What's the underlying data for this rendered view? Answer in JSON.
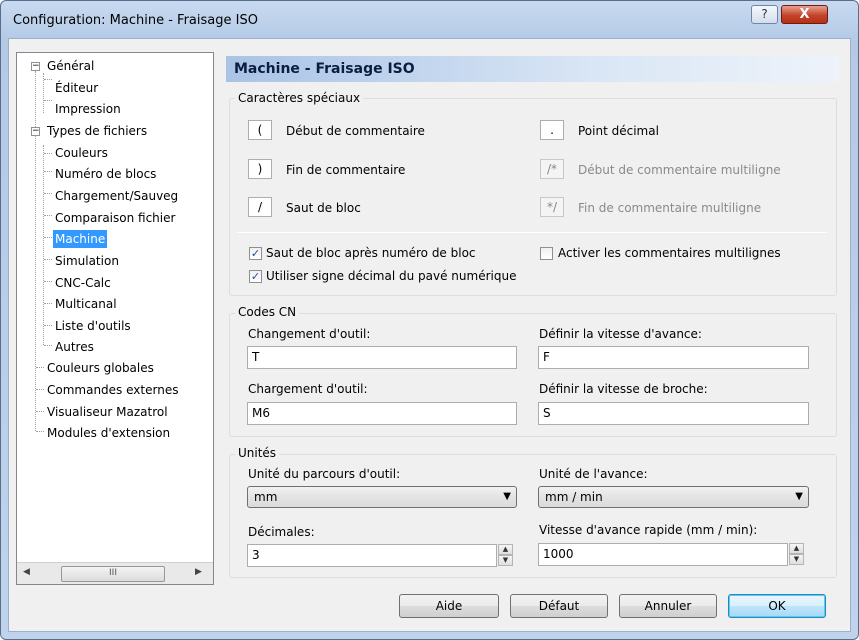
{
  "window": {
    "title": "Configuration: Machine - Fraisage ISO",
    "help_glyph": "?",
    "close_glyph": "X"
  },
  "tree": {
    "items": [
      {
        "label": "Général"
      },
      {
        "label": "Éditeur"
      },
      {
        "label": "Impression"
      },
      {
        "label": "Types de fichiers"
      },
      {
        "label": "Couleurs"
      },
      {
        "label": "Numéro de blocs"
      },
      {
        "label": "Chargement/Sauveg"
      },
      {
        "label": "Comparaison fichier"
      },
      {
        "label": "Machine"
      },
      {
        "label": "Simulation"
      },
      {
        "label": "CNC-Calc"
      },
      {
        "label": "Multicanal"
      },
      {
        "label": "Liste d'outils"
      },
      {
        "label": "Autres"
      },
      {
        "label": "Couleurs globales"
      },
      {
        "label": "Commandes externes"
      },
      {
        "label": "Visualiseur Mazatrol"
      },
      {
        "label": "Modules d'extension"
      }
    ],
    "expander_glyph": "−",
    "scroll_thumb_glyph": "III"
  },
  "panel": {
    "title": "Machine - Fraisage ISO"
  },
  "special_chars": {
    "group_label": "Caractères spéciaux",
    "comment_start": {
      "char": "(",
      "label": "Début de commentaire"
    },
    "comment_end": {
      "char": ")",
      "label": "Fin de commentaire"
    },
    "block_skip": {
      "char": "/",
      "label": "Saut de bloc"
    },
    "decimal_point": {
      "char": ".",
      "label": "Point décimal"
    },
    "ml_comment_start": {
      "char": "/*",
      "label": "Début de commentaire multiligne"
    },
    "ml_comment_end": {
      "char": "*/",
      "label": "Fin de commentaire multiligne"
    },
    "check_block_skip_after_number": {
      "label": "Saut de bloc après numéro de bloc",
      "checked": true
    },
    "check_numpad_decimal": {
      "label": "Utiliser signe décimal du pavé numérique",
      "checked": true
    },
    "check_multiline_comments": {
      "label": "Activer les commentaires multilignes",
      "checked": false
    }
  },
  "nc_codes": {
    "group_label": "Codes CN",
    "tool_change": {
      "label": "Changement d'outil:",
      "value": "T"
    },
    "tool_load": {
      "label": "Chargement d'outil:",
      "value": "M6"
    },
    "feed_rate": {
      "label": "Définir la vitesse d'avance:",
      "value": "F"
    },
    "spindle_speed": {
      "label": "Définir la vitesse de broche:",
      "value": "S"
    }
  },
  "units": {
    "group_label": "Unités",
    "toolpath_unit": {
      "label": "Unité du parcours d'outil:",
      "value": "mm"
    },
    "feed_unit": {
      "label": "Unité de l'avance:",
      "value": "mm / min"
    },
    "decimals": {
      "label": "Décimales:",
      "value": "3"
    },
    "rapid_feed": {
      "label": "Vitesse d'avance rapide (mm / min):",
      "value": "1000"
    }
  },
  "buttons": {
    "help": "Aide",
    "default": "Défaut",
    "cancel": "Annuler",
    "ok": "OK"
  }
}
